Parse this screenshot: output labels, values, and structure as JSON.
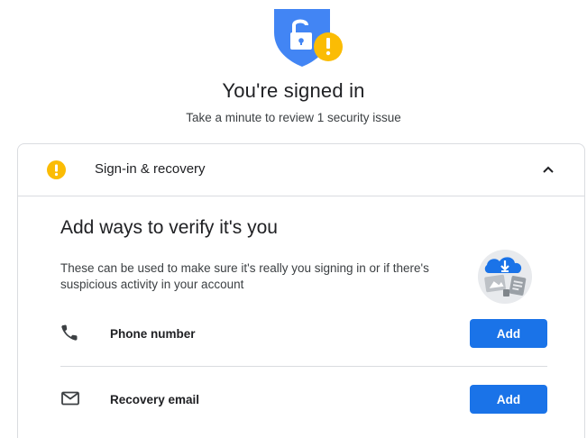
{
  "header": {
    "title": "You're signed in",
    "subtitle": "Take a minute to review 1 security issue"
  },
  "card": {
    "section_label": "Sign-in & recovery",
    "expanded": true
  },
  "verify": {
    "title": "Add ways to verify it's you",
    "description": "These can be used to make sure it's really you signing in or if there's suspicious activity in your account"
  },
  "items": [
    {
      "icon": "phone-icon",
      "label": "Phone number",
      "button": "Add"
    },
    {
      "icon": "mail-icon",
      "label": "Recovery email",
      "button": "Add"
    }
  ],
  "colors": {
    "accent": "#1a73e8",
    "warning": "#fbbc04",
    "shield": "#4285f4"
  }
}
